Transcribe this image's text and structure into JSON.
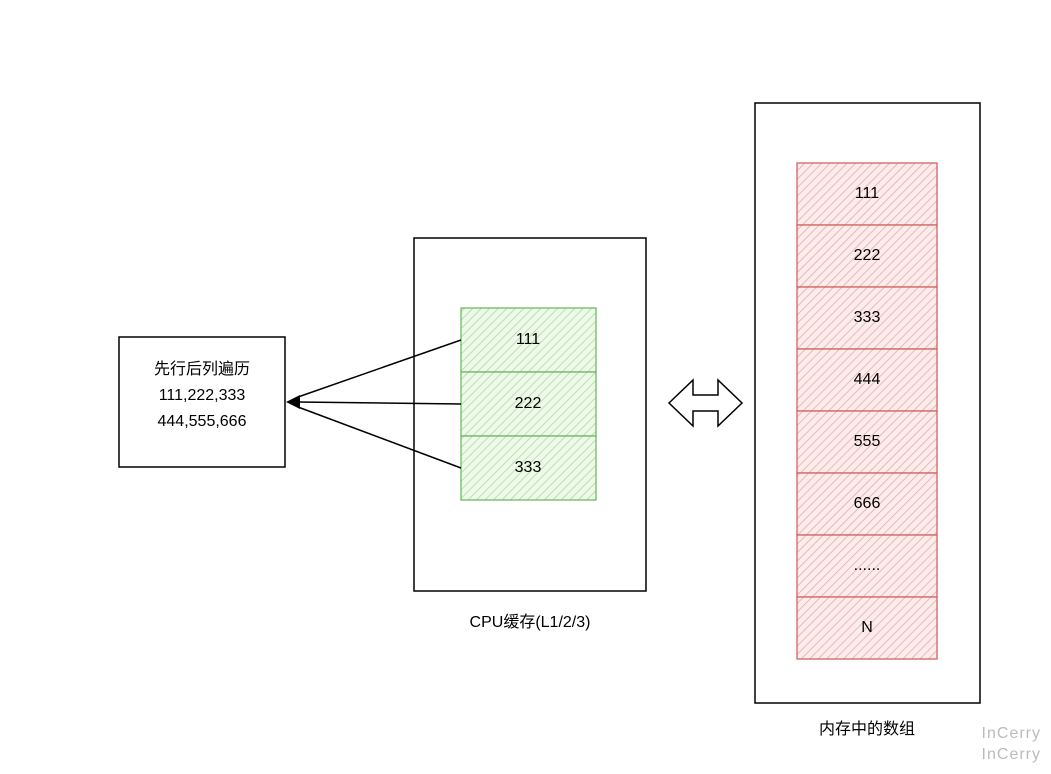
{
  "left_box": {
    "title": "先行后列遍历",
    "line1": "111,222,333",
    "line2": "444,555,666"
  },
  "cache": {
    "caption": "CPU缓存(L1/2/3)",
    "cells": [
      "111",
      "222",
      "333"
    ]
  },
  "memory": {
    "caption": "内存中的数组",
    "cells": [
      "111",
      "222",
      "333",
      "444",
      "555",
      "666",
      "......",
      "N"
    ]
  },
  "watermark": "InCerry"
}
